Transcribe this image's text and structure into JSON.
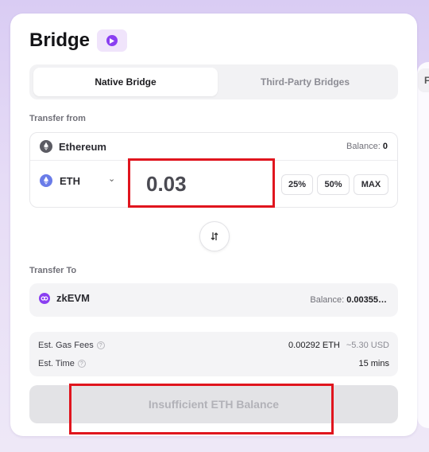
{
  "header": {
    "title": "Bridge",
    "badge_icon": "play-icon"
  },
  "tabs": [
    {
      "label": "Native Bridge",
      "active": true
    },
    {
      "label": "Third-Party Bridges",
      "active": false
    }
  ],
  "side_peek": {
    "label": "F"
  },
  "transfer_from": {
    "section_label": "Transfer from",
    "chain": {
      "name": "Ethereum",
      "icon": "ethereum-icon"
    },
    "balance_label": "Balance:",
    "balance_value": "0",
    "token": {
      "name": "ETH",
      "icon": "eth-token-icon"
    },
    "amount": "0.03",
    "percent_buttons": [
      "25%",
      "50%",
      "MAX"
    ]
  },
  "transfer_to": {
    "section_label": "Transfer To",
    "chain": {
      "name": "zkEVM",
      "icon": "zkevm-icon"
    },
    "balance_label": "Balance:",
    "balance_value": "0.00355…"
  },
  "fees": {
    "gas_label": "Est. Gas Fees",
    "gas_value": "0.00292 ETH",
    "gas_usd": "~5.30 USD",
    "time_label": "Est. Time",
    "time_value": "15 mins"
  },
  "submit": {
    "label": "Insufficient ETH Balance",
    "disabled": true
  },
  "colors": {
    "accent_purple": "#8a3ff1",
    "highlight_red": "#e0151e",
    "background_lavender": "#d9ccf3"
  }
}
